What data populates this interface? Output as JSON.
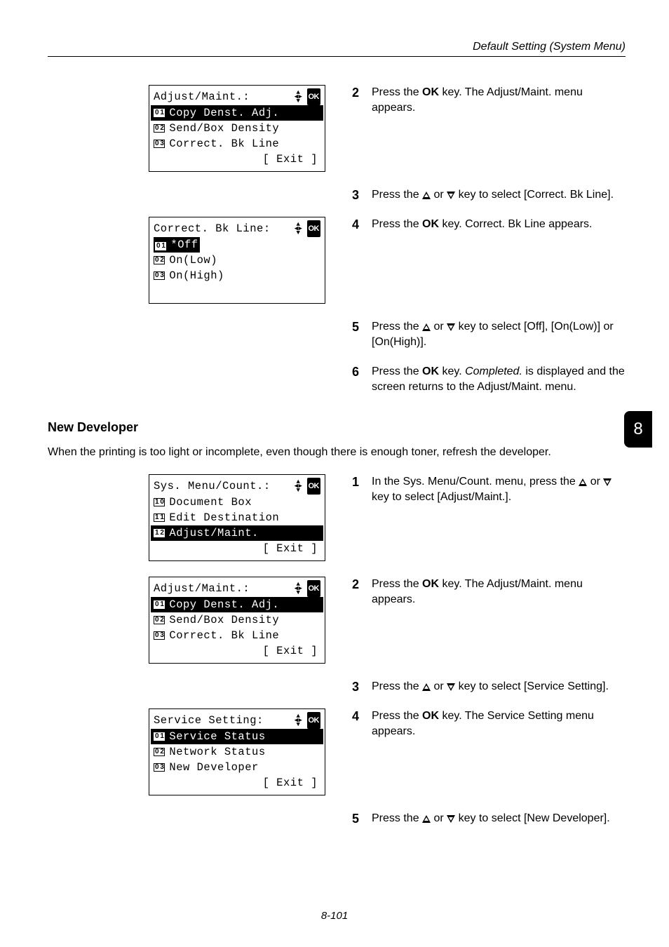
{
  "header": {
    "section_title": "Default Setting (System Menu)"
  },
  "thumb": {
    "label": "8"
  },
  "footer": {
    "page_num": "8-101"
  },
  "lcd1": {
    "title": "Adjust/Maint.:",
    "l1_num": "0 1",
    "l1": "Copy Denst. Adj.",
    "l2_num": "0 2",
    "l2": "Send/Box Density",
    "l3_num": "0 3",
    "l3": "Correct. Bk Line",
    "exit": "[  Exit  ]"
  },
  "lcd2": {
    "title": "Correct. Bk Line:",
    "l1_num": "0 1",
    "l1": "*Off",
    "l2_num": "0 2",
    "l2": "On(Low)",
    "l3_num": "0 3",
    "l3": "On(High)"
  },
  "lcd3": {
    "title": "Sys. Menu/Count.:",
    "l1_num": "1 0",
    "l1": "Document Box",
    "l2_num": "1 1",
    "l2": "Edit Destination",
    "l3_num": "1 2",
    "l3": "Adjust/Maint.",
    "exit": "[  Exit  ]"
  },
  "lcd4": {
    "title": "Adjust/Maint.:",
    "l1_num": "0 1",
    "l1": "Copy Denst. Adj.",
    "l2_num": "0 2",
    "l2": "Send/Box Density",
    "l3_num": "0 3",
    "l3": "Correct. Bk Line",
    "exit": "[  Exit  ]"
  },
  "lcd5": {
    "title": "Service Setting:",
    "l1_num": "0 1",
    "l1": "Service Status",
    "l2_num": "0 2",
    "l2": "Network Status",
    "l3_num": "0 3",
    "l3": "New Developer",
    "exit": "[  Exit  ]"
  },
  "stepsA": {
    "s2n": "2",
    "s2a": "Press the ",
    "s2b": "OK",
    "s2c": " key. The Adjust/Maint. menu appears.",
    "s3n": "3",
    "s3a": "Press the ",
    "s3b": " or ",
    "s3c": " key to select [Correct. Bk Line].",
    "s4n": "4",
    "s4a": "Press the ",
    "s4b": "OK",
    "s4c": " key. Correct. Bk Line appears.",
    "s5n": "5",
    "s5a": "Press the ",
    "s5b": " or ",
    "s5c": " key to select [Off], [On(Low)] or [On(High)].",
    "s6n": "6",
    "s6a": "Press the ",
    "s6b": "OK",
    "s6c": " key. ",
    "s6d": "Completed.",
    "s6e": " is displayed and the screen returns to the Adjust/Maint. menu."
  },
  "sectionB": {
    "heading": "New Developer",
    "intro": "When the printing is too light or incomplete, even though there is enough toner, refresh the developer."
  },
  "stepsB": {
    "s1n": "1",
    "s1a": "In the Sys. Menu/Count. menu, press the ",
    "s1b": " or ",
    "s1c": " key to select [Adjust/Maint.].",
    "s2n": "2",
    "s2a": "Press the ",
    "s2b": "OK",
    "s2c": " key. The Adjust/Maint. menu appears.",
    "s3n": "3",
    "s3a": "Press the ",
    "s3b": " or ",
    "s3c": " key to select [Service Setting].",
    "s4n": "4",
    "s4a": "Press the ",
    "s4b": "OK",
    "s4c": " key. The Service Setting menu appears.",
    "s5n": "5",
    "s5a": "Press the ",
    "s5b": " or ",
    "s5c": " key to select [New Developer]."
  }
}
